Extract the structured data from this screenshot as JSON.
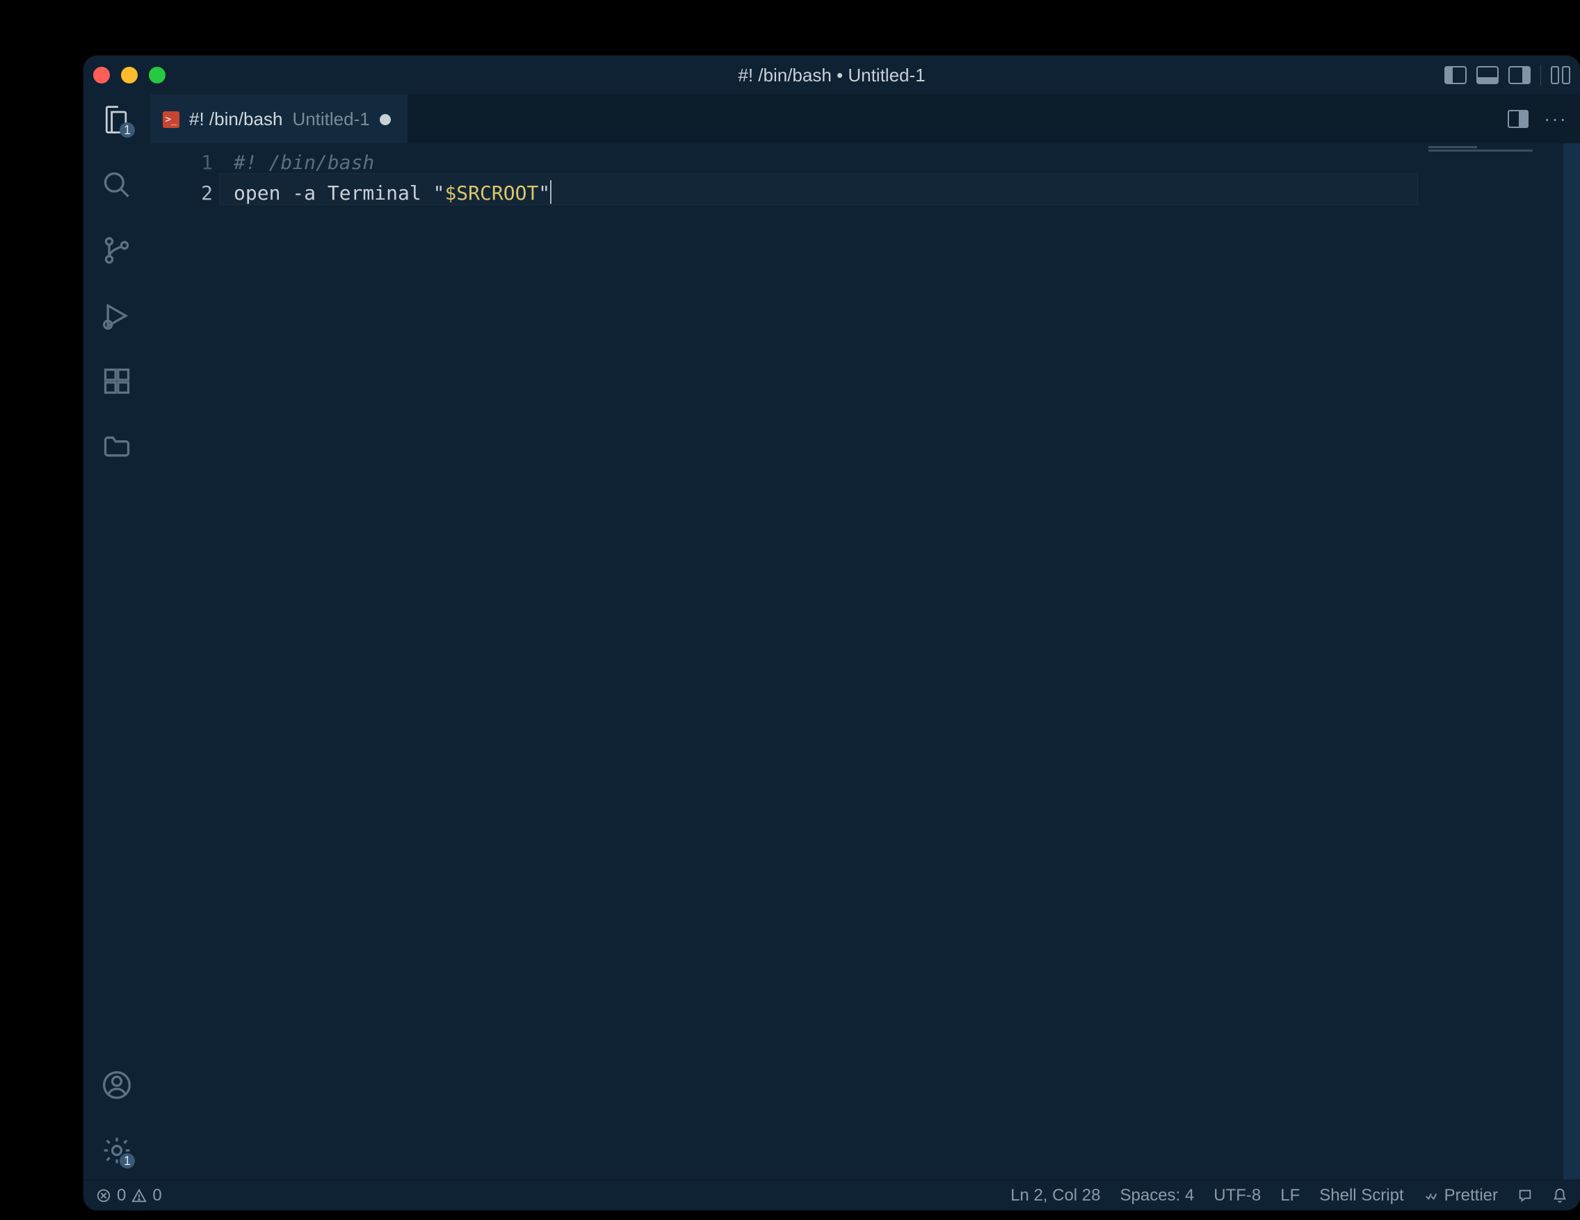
{
  "window": {
    "title": "#! /bin/bash • Untitled-1"
  },
  "tab": {
    "language_label": "#! /bin/bash",
    "filename": "Untitled-1"
  },
  "editor": {
    "lines": [
      {
        "n": "1",
        "type": "comment",
        "text": "#! /bin/bash"
      },
      {
        "n": "2",
        "type": "code",
        "prefix": "open -a Terminal \"",
        "var": "$SRCROOT",
        "suffix": "\""
      }
    ]
  },
  "activitybar": {
    "explorer_badge": "1",
    "settings_badge": "1"
  },
  "status": {
    "errors": "0",
    "warnings": "0",
    "cursor": "Ln 2, Col 28",
    "indent": "Spaces: 4",
    "encoding": "UTF-8",
    "eol": "LF",
    "language": "Shell Script",
    "formatter": "Prettier"
  }
}
